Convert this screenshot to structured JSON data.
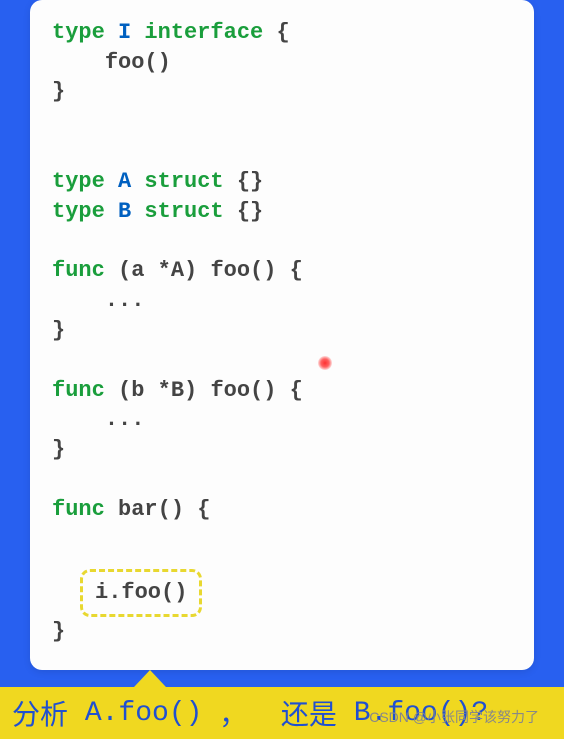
{
  "code": {
    "keywords": {
      "type": "type",
      "interface": "interface",
      "struct": "struct",
      "func": "func"
    },
    "interface_name": "I",
    "interface_method": "foo()",
    "struct_a": "A",
    "struct_b": "B",
    "empty_braces": "{}",
    "receiver_a": "(a *A)",
    "receiver_b": "(b *B)",
    "method_foo": "foo()",
    "method_bar": "bar()",
    "open_brace": "{",
    "close_brace": "}",
    "ellipsis": "...",
    "highlighted_call": "i.foo()"
  },
  "question": {
    "prefix": "分析",
    "option_a": "A.foo()",
    "comma": "，",
    "middle": "还是",
    "option_b": "B.foo()?"
  },
  "watermark": "CSDN @小张同学该努力了"
}
